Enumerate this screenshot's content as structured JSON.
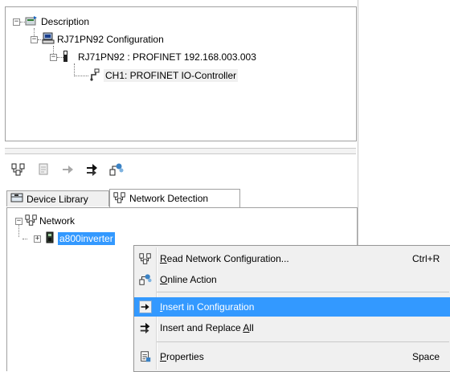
{
  "top_tree": {
    "root_label": "Description",
    "config_label": "RJ71PN92 Configuration",
    "device_label": "RJ71PN92 : PROFINET 192.168.003.003",
    "channel_label": "CH1: PROFINET IO-Controller"
  },
  "toolbar": {
    "icons": [
      "network-scan-icon",
      "properties-icon",
      "insert-icon",
      "insert-replace-icon",
      "online-action-icon"
    ]
  },
  "tabs": [
    {
      "label": "Device Library",
      "icon": "library-icon",
      "active": false
    },
    {
      "label": "Network Detection",
      "icon": "network-scan-icon",
      "active": true
    }
  ],
  "network_tree": {
    "root_label": "Network",
    "device_label": "a800inverter"
  },
  "context_menu": {
    "items": [
      {
        "label_pre": "",
        "label_mn": "R",
        "label_post": "ead Network Configuration...",
        "shortcut": "Ctrl+R",
        "icon": "network-scan-icon",
        "highlighted": false
      },
      {
        "label_pre": "",
        "label_mn": "O",
        "label_post": "nline Action",
        "shortcut": "",
        "icon": "online-action-icon",
        "highlighted": false
      },
      {
        "label_pre": "",
        "label_mn": "I",
        "label_post": "nsert in Configuration",
        "shortcut": "",
        "icon": "insert-icon",
        "highlighted": true
      },
      {
        "label_pre": "Insert and Replace ",
        "label_mn": "A",
        "label_post": "ll",
        "shortcut": "",
        "icon": "insert-replace-icon",
        "highlighted": false
      },
      {
        "label_pre": "",
        "label_mn": "P",
        "label_post": "roperties",
        "shortcut": "Space",
        "icon": "properties-icon",
        "highlighted": false
      }
    ]
  }
}
